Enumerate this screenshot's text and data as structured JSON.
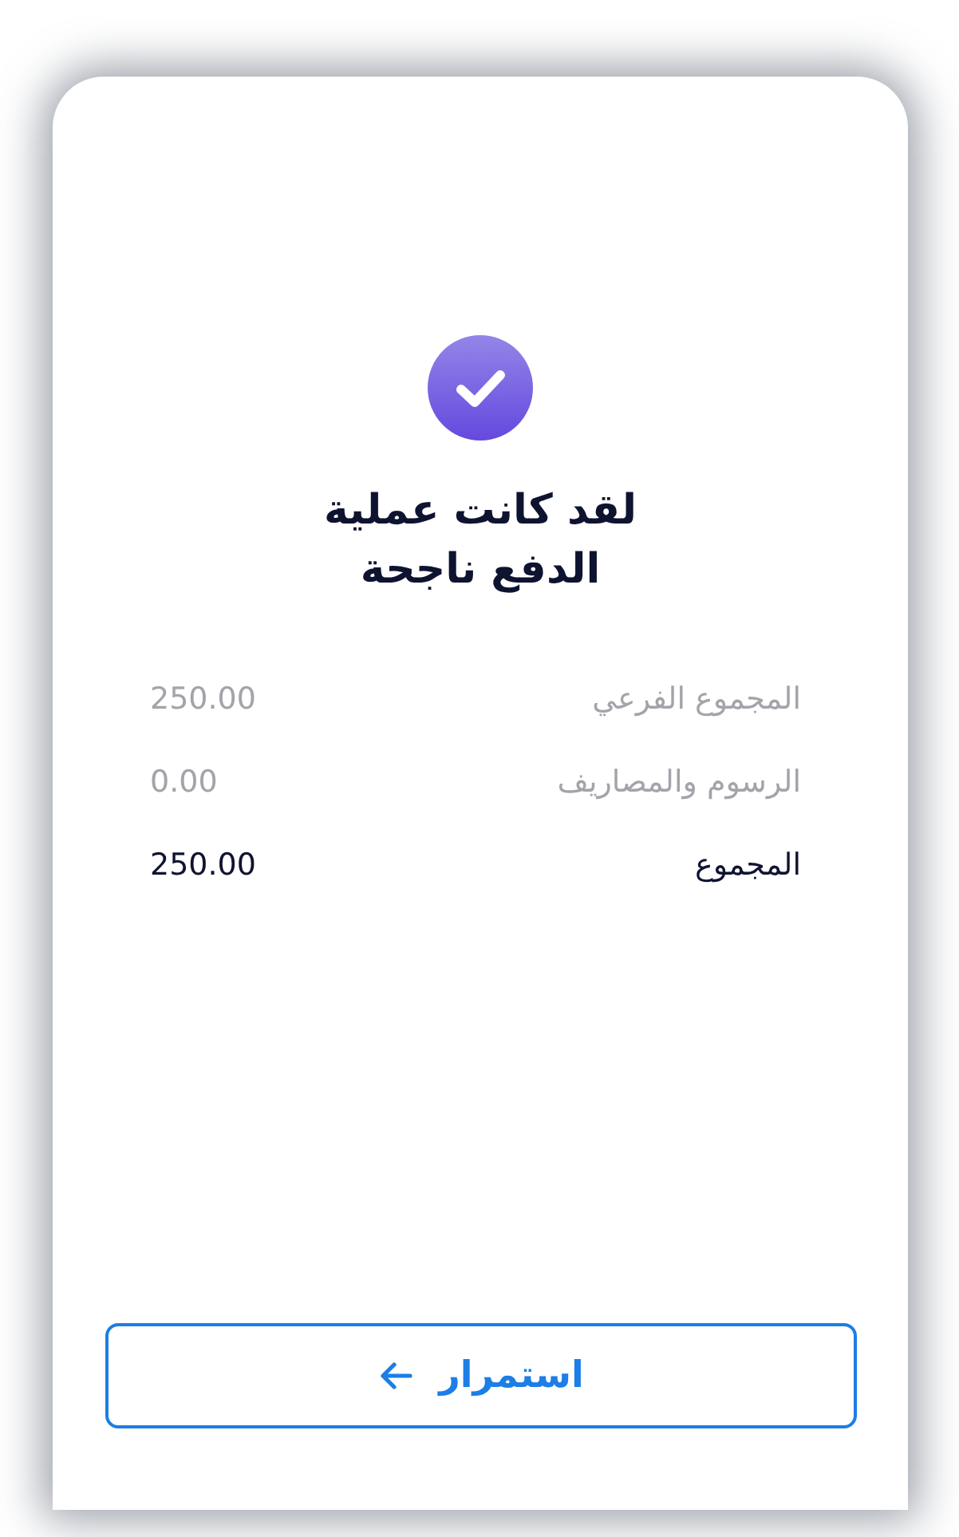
{
  "status": {
    "kind": "success",
    "title": "لقد كانت عملية الدفع ناجحة"
  },
  "summary": {
    "rows": [
      {
        "label": "المجموع الفرعي",
        "value": "250.00",
        "emphasis": false
      },
      {
        "label": "الرسوم والمصاريف",
        "value": "0.00",
        "emphasis": false
      },
      {
        "label": "المجموع",
        "value": "250.00",
        "emphasis": true
      }
    ]
  },
  "button": {
    "label": "استمرار"
  }
}
